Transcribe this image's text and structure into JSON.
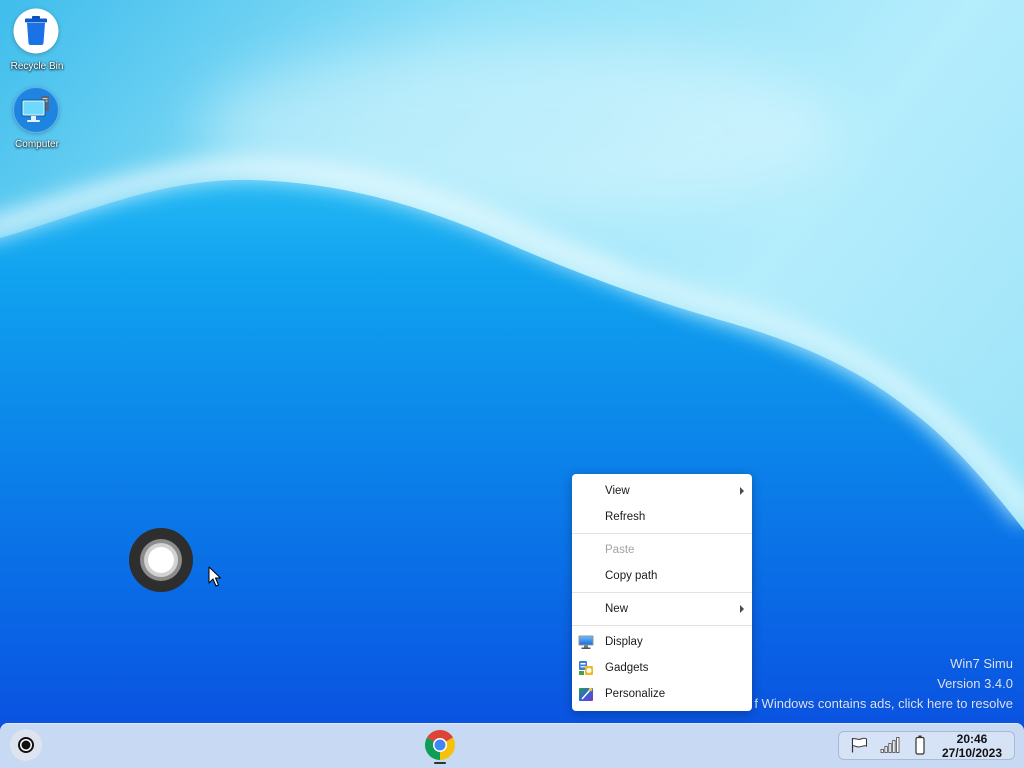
{
  "desktop": {
    "icons": [
      {
        "label": "Recycle Bin",
        "icon": "recycle-bin-icon"
      },
      {
        "label": "Computer",
        "icon": "computer-icon"
      }
    ],
    "assistive_touch": {
      "icon": "assistive-touch-icon"
    },
    "cursor": {
      "icon": "arrow-cursor-icon"
    }
  },
  "context_menu": {
    "groups": [
      [
        {
          "label": "View",
          "has_submenu": true,
          "enabled": true
        },
        {
          "label": "Refresh",
          "has_submenu": false,
          "enabled": true
        }
      ],
      [
        {
          "label": "Paste",
          "has_submenu": false,
          "enabled": false
        },
        {
          "label": "Copy path",
          "has_submenu": false,
          "enabled": true
        }
      ],
      [
        {
          "label": "New",
          "has_submenu": true,
          "enabled": true
        }
      ],
      [
        {
          "label": "Display",
          "icon": "display-icon",
          "enabled": true
        },
        {
          "label": "Gadgets",
          "icon": "gadgets-icon",
          "enabled": true
        },
        {
          "label": "Personalize",
          "icon": "personalize-icon",
          "enabled": true
        }
      ]
    ]
  },
  "watermark": {
    "title": "Win7 Simu",
    "version": "Version 3.4.0",
    "notice": "f Windows contains ads, click here to resolve"
  },
  "taskbar": {
    "start_icon": "start-orb-icon",
    "pinned_apps": [
      {
        "icon": "chrome-icon",
        "running": true
      }
    ],
    "tray": {
      "icons": [
        "flag-icon",
        "signal-bars-icon",
        "battery-icon"
      ],
      "time": "20:46",
      "date": "27/10/2023"
    }
  },
  "colors": {
    "menu_text": "#1b1b1b",
    "menu_disabled_text": "#a3a3a3",
    "taskbar_background": "#c8d9f3",
    "watermark_text": "rgba(255,255,255,0.85)"
  }
}
